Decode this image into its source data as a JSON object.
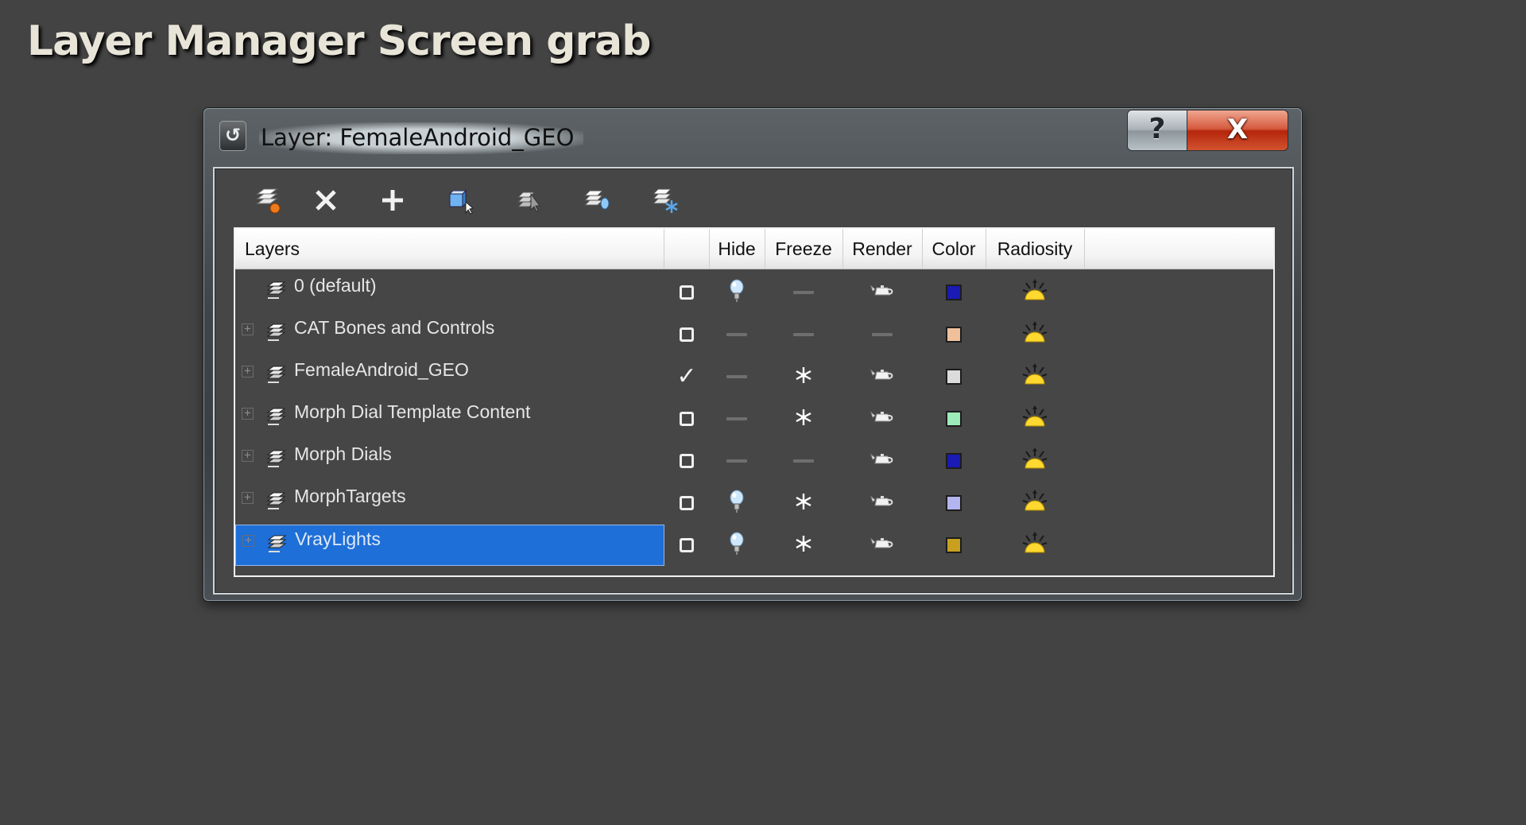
{
  "page_heading": "Layer Manager Screen grab",
  "window": {
    "title": "Layer: FemaleAndroid_GEO",
    "app_icon": "3ds-max-logo-icon",
    "help_label": "?",
    "close_label": "X"
  },
  "toolbar": {
    "buttons": [
      {
        "name": "create-new-layer",
        "icon": "new-layer-icon"
      },
      {
        "name": "delete-layer",
        "icon": "delete-x-icon"
      },
      {
        "name": "add-selected-to-layer",
        "icon": "plus-icon"
      },
      {
        "name": "select-objects-in-layer",
        "icon": "select-objects-icon"
      },
      {
        "name": "highlight-selected-layers",
        "icon": "highlight-layers-icon"
      },
      {
        "name": "hide-unhide-all-layers",
        "icon": "hide-layers-icon"
      },
      {
        "name": "freeze-unfreeze-all-layers",
        "icon": "freeze-layers-icon"
      }
    ]
  },
  "columns": {
    "layers": "Layers",
    "current": "",
    "hide": "Hide",
    "freeze": "Freeze",
    "render": "Render",
    "color": "Color",
    "radiosity": "Radiosity"
  },
  "layers": [
    {
      "name": "0 (default)",
      "expandable": false,
      "current": false,
      "hide": true,
      "freeze": false,
      "render": true,
      "color": "#1a1ab4",
      "radiosity": true,
      "selected": false
    },
    {
      "name": "CAT Bones and Controls",
      "expandable": true,
      "current": false,
      "hide": false,
      "freeze": false,
      "render": false,
      "color": "#f0c09a",
      "radiosity": true,
      "selected": false
    },
    {
      "name": "FemaleAndroid_GEO",
      "expandable": true,
      "current": true,
      "hide": false,
      "freeze": true,
      "render": true,
      "color": "#dcdcdc",
      "radiosity": true,
      "selected": false
    },
    {
      "name": "Morph Dial Template Content",
      "expandable": true,
      "current": false,
      "hide": false,
      "freeze": true,
      "render": true,
      "color": "#9cebb8",
      "radiosity": true,
      "selected": false
    },
    {
      "name": "Morph Dials",
      "expandable": true,
      "current": false,
      "hide": false,
      "freeze": false,
      "render": true,
      "color": "#1a1ab4",
      "radiosity": true,
      "selected": false
    },
    {
      "name": "MorphTargets",
      "expandable": true,
      "current": false,
      "hide": true,
      "freeze": true,
      "render": true,
      "color": "#b4b4f0",
      "radiosity": true,
      "selected": false
    },
    {
      "name": "VrayLights",
      "expandable": true,
      "current": false,
      "hide": true,
      "freeze": true,
      "render": true,
      "color": "#c8a020",
      "radiosity": true,
      "selected": true
    }
  ]
}
